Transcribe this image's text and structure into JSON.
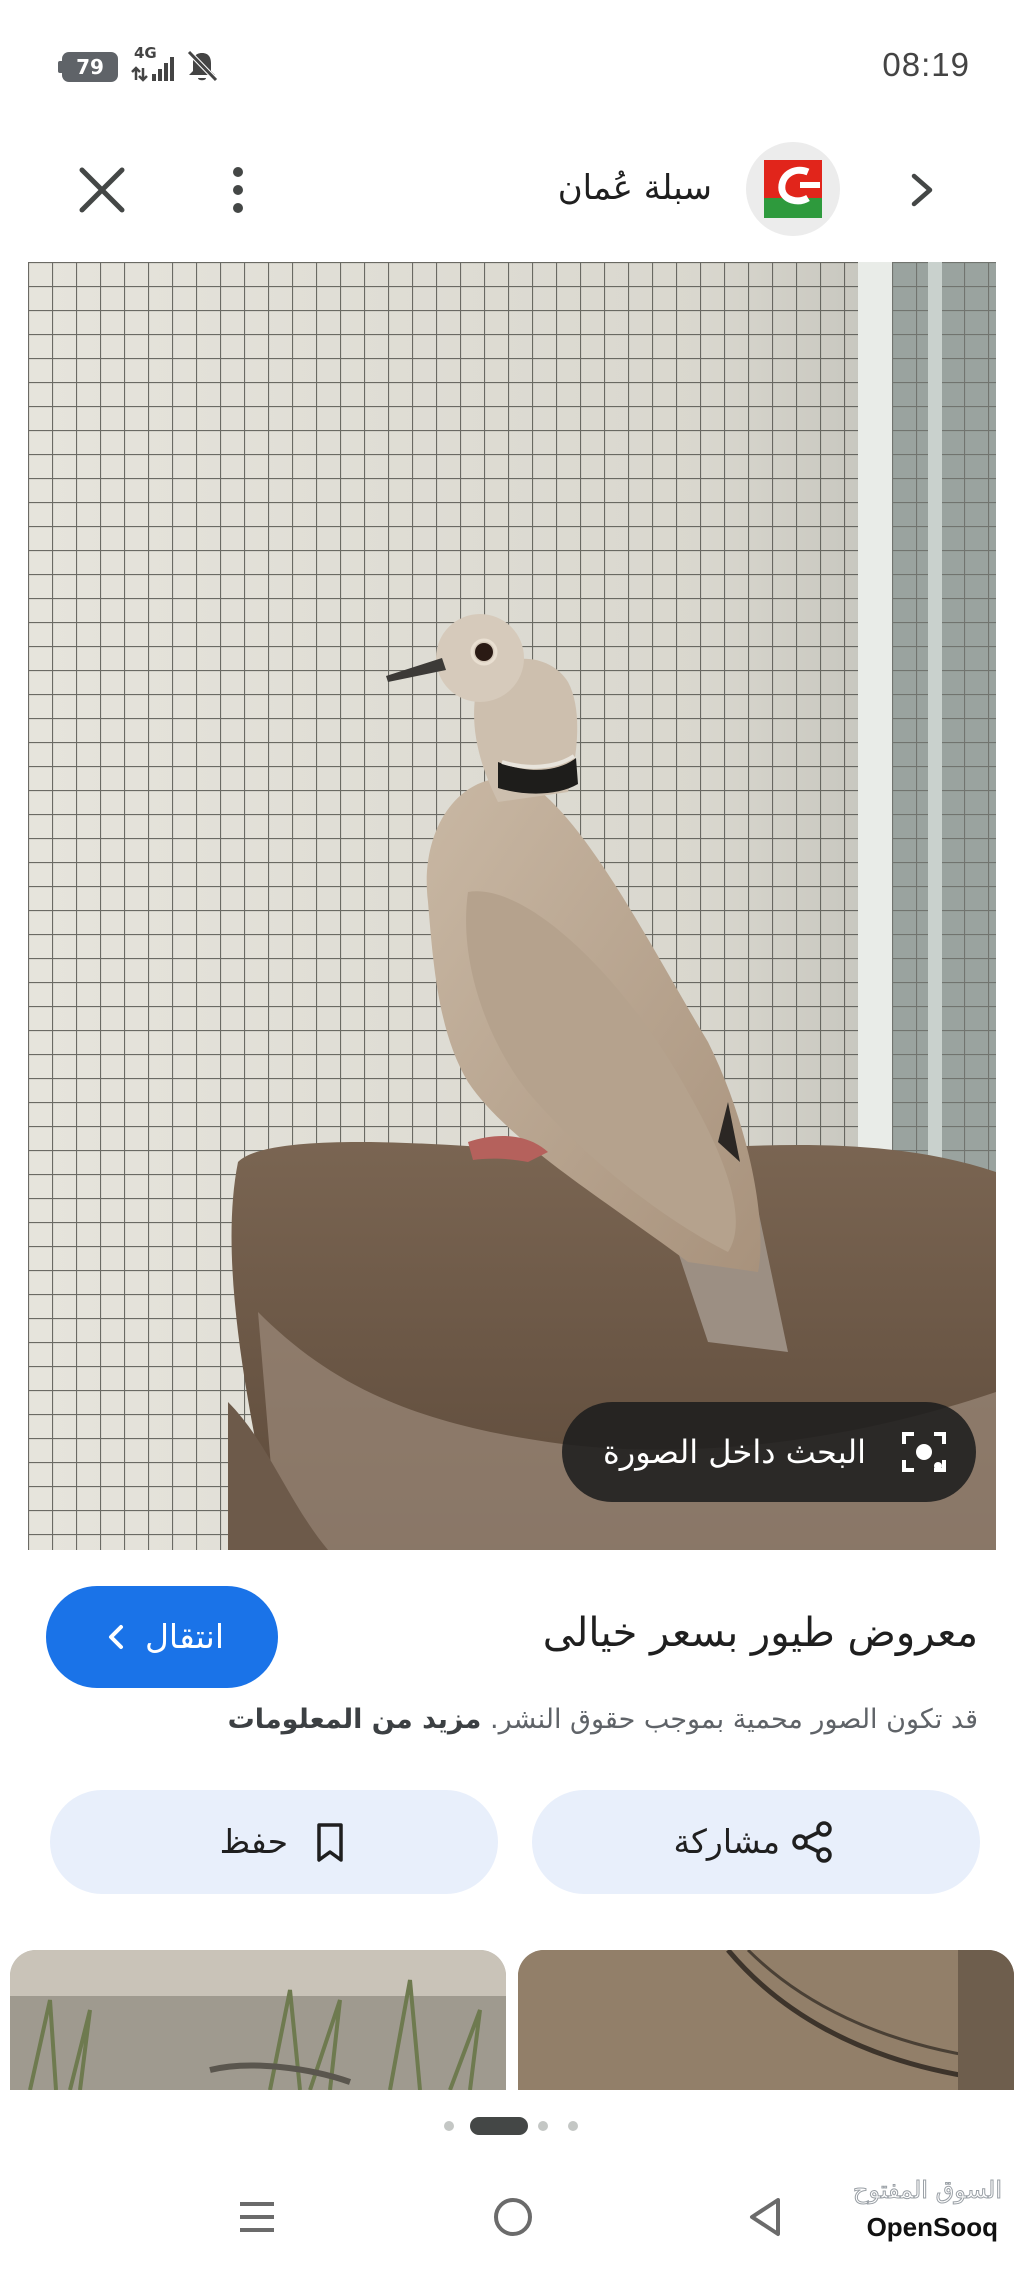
{
  "status_bar": {
    "battery": "79",
    "network": "4G",
    "time": "08:19",
    "icons": [
      "battery-icon",
      "signal-icon",
      "mute-icon"
    ]
  },
  "top_bar": {
    "site_name": "سبلة عُمان",
    "icons": [
      "close-icon",
      "more-vert-icon",
      "site-logo",
      "chevron-right-icon"
    ],
    "logo_colors": {
      "red": "#e1251b",
      "green": "#2e9a3d",
      "white": "#ffffff"
    }
  },
  "image": {
    "lens_label": "البحث داخل الصورة",
    "lens_icon": "lens-camera-icon"
  },
  "info": {
    "title": "معروض طيور بسعر خيالى",
    "visit_label": "انتقال",
    "copyright_text": "قد تكون الصور محمية بموجب حقوق النشر.",
    "more_info_label": "مزيد من المعلومات"
  },
  "actions": {
    "share_label": "مشاركة",
    "save_label": "حفظ",
    "share_icon": "share-icon",
    "save_icon": "bookmark-icon"
  },
  "pager": {
    "count": 4,
    "active": 1
  },
  "nav_bar": {
    "icons": [
      "recent-apps-icon",
      "home-icon",
      "back-icon"
    ]
  },
  "watermark": {
    "arabic": "السوق المفتوح",
    "latin": "OpenSooq"
  },
  "colors": {
    "accent": "#1a73e8",
    "chip_bg": "#e8effb",
    "text": "#1f1f1f",
    "secondary_text": "#5f6368"
  }
}
